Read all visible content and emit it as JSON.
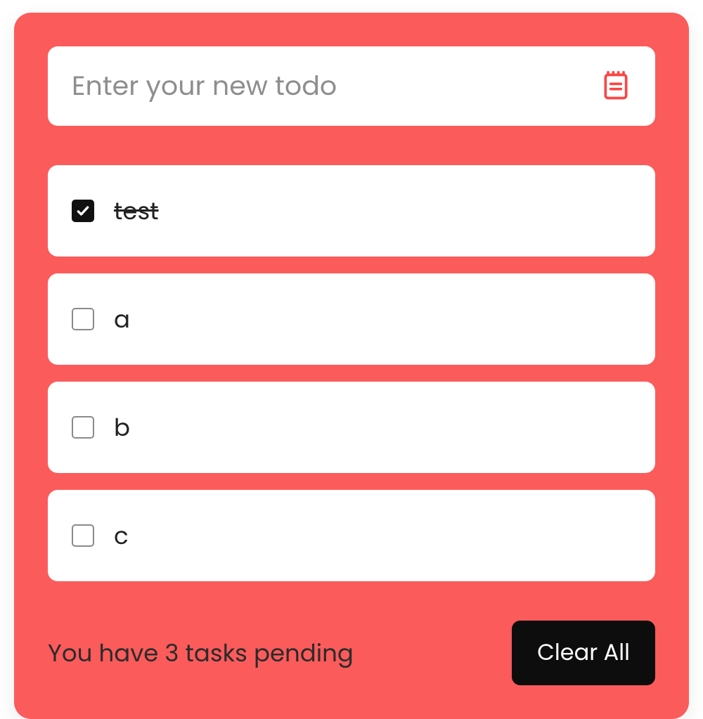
{
  "colors": {
    "accent": "#fc5b5b",
    "button_bg": "#0d0d0d"
  },
  "input": {
    "placeholder": "Enter your new todo",
    "value": "",
    "add_icon": "calendar-note-icon"
  },
  "todos": [
    {
      "label": "test",
      "done": true
    },
    {
      "label": "a",
      "done": false
    },
    {
      "label": "b",
      "done": false
    },
    {
      "label": "c",
      "done": false
    }
  ],
  "footer": {
    "pending_text": "You have 3 tasks pending",
    "pending_count": 3,
    "clear_label": "Clear All"
  }
}
